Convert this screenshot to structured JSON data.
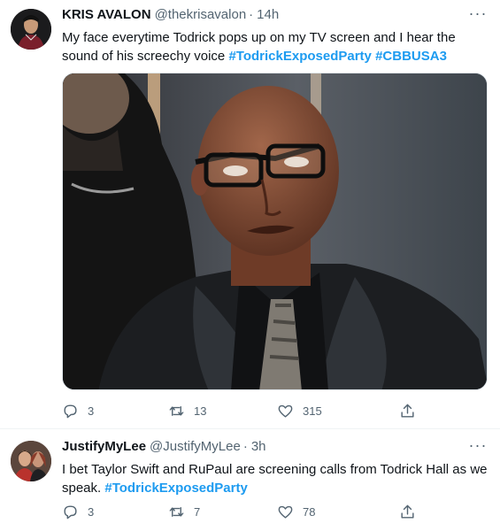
{
  "tweets": [
    {
      "author_name": "KRIS AVALON",
      "handle": "@thekrisavalon",
      "separator": "·",
      "time": "14h",
      "text_plain": "My face everytime Todrick pops up on my TV screen and I hear the sound of his screechy voice ",
      "hashtags": [
        "#TodrickExposedParty",
        "#CBBUSA3"
      ],
      "reply_count": "3",
      "retweet_count": "13",
      "like_count": "315",
      "more_label": "···",
      "icons": {
        "reply": "reply-icon",
        "retweet": "retweet-icon",
        "like": "heart-icon",
        "share": "share-icon"
      }
    },
    {
      "author_name": "JustifyMyLee",
      "handle": "@JustifyMyLee",
      "separator": "·",
      "time": "3h",
      "text_plain": "I bet Taylor Swift and RuPaul are screening calls from Todrick Hall as we speak. ",
      "hashtags": [
        "#TodrickExposedParty"
      ],
      "reply_count": "3",
      "retweet_count": "7",
      "like_count": "78",
      "more_label": "···",
      "icons": {
        "reply": "reply-icon",
        "retweet": "retweet-icon",
        "like": "heart-icon",
        "share": "share-icon"
      }
    }
  ],
  "colors": {
    "hashtag": "#1d9bf0",
    "secondary_text": "#536471",
    "primary_text": "#0f1419",
    "divider": "#eff3f4"
  }
}
